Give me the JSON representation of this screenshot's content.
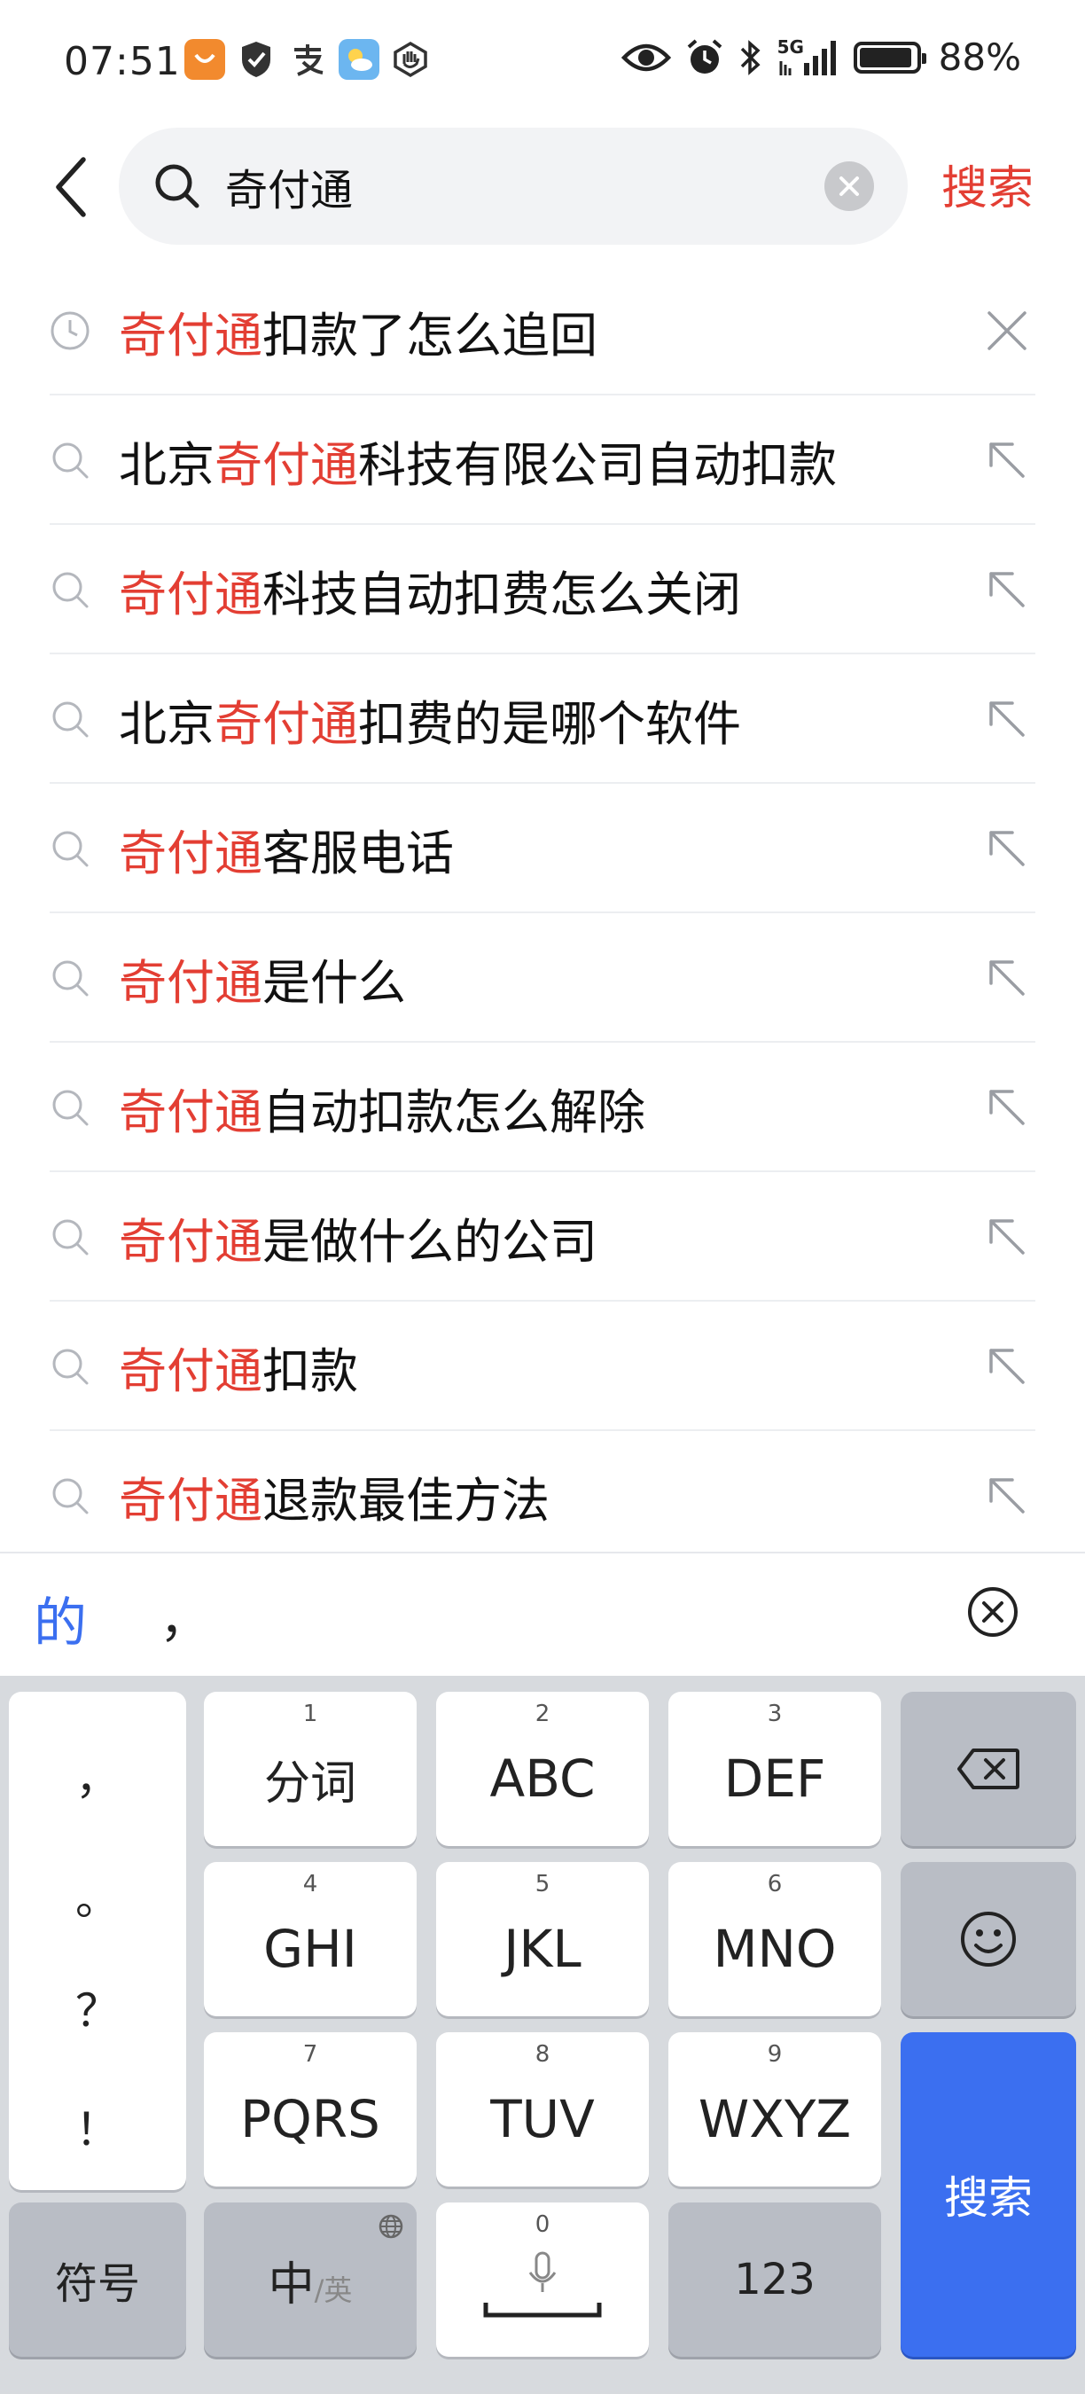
{
  "status_bar": {
    "time": "07:51",
    "network": "5G",
    "battery": "88%",
    "icons": [
      "shopping-app-icon",
      "shield-icon",
      "alipay-icon",
      "weather-icon",
      "hand-icon",
      "eye-icon",
      "alarm-icon",
      "bluetooth-icon",
      "signal-icon",
      "battery-icon"
    ]
  },
  "search": {
    "query": "奇付通",
    "submit_label": "搜索"
  },
  "suggestions": [
    {
      "type": "history",
      "before": "",
      "highlight": "奇付通",
      "after": "扣款了怎么追回"
    },
    {
      "type": "suggest",
      "before": "北京",
      "highlight": "奇付通",
      "after": "科技有限公司自动扣款"
    },
    {
      "type": "suggest",
      "before": "",
      "highlight": "奇付通",
      "after": "科技自动扣费怎么关闭"
    },
    {
      "type": "suggest",
      "before": "北京",
      "highlight": "奇付通",
      "after": "扣费的是哪个软件"
    },
    {
      "type": "suggest",
      "before": "",
      "highlight": "奇付通",
      "after": "客服电话"
    },
    {
      "type": "suggest",
      "before": "",
      "highlight": "奇付通",
      "after": "是什么"
    },
    {
      "type": "suggest",
      "before": "",
      "highlight": "奇付通",
      "after": "自动扣款怎么解除"
    },
    {
      "type": "suggest",
      "before": "",
      "highlight": "奇付通",
      "after": "是做什么的公司"
    },
    {
      "type": "suggest",
      "before": "",
      "highlight": "奇付通",
      "after": "扣款"
    },
    {
      "type": "suggest",
      "before": "",
      "highlight": "奇付通",
      "after": "退款最佳方法"
    }
  ],
  "ime": {
    "candidates": [
      "的",
      "，"
    ],
    "punctuation": [
      "，",
      "。",
      "？",
      "！"
    ],
    "keys": {
      "k1": {
        "num": "1",
        "label": "分词"
      },
      "k2": {
        "num": "2",
        "label": "ABC"
      },
      "k3": {
        "num": "3",
        "label": "DEF"
      },
      "k4": {
        "num": "4",
        "label": "GHI"
      },
      "k5": {
        "num": "5",
        "label": "JKL"
      },
      "k6": {
        "num": "6",
        "label": "MNO"
      },
      "k7": {
        "num": "7",
        "label": "PQRS"
      },
      "k8": {
        "num": "8",
        "label": "TUV"
      },
      "k9": {
        "num": "9",
        "label": "WXYZ"
      },
      "k0": {
        "num": "0"
      },
      "symbols": "符号",
      "lang_main": "中",
      "lang_sub": "/英",
      "numbers": "123",
      "search": "搜索"
    }
  },
  "colors": {
    "highlight": "#e33e33",
    "accent_blue": "#3b6ff0",
    "keyboard_bg": "#d7dade"
  }
}
